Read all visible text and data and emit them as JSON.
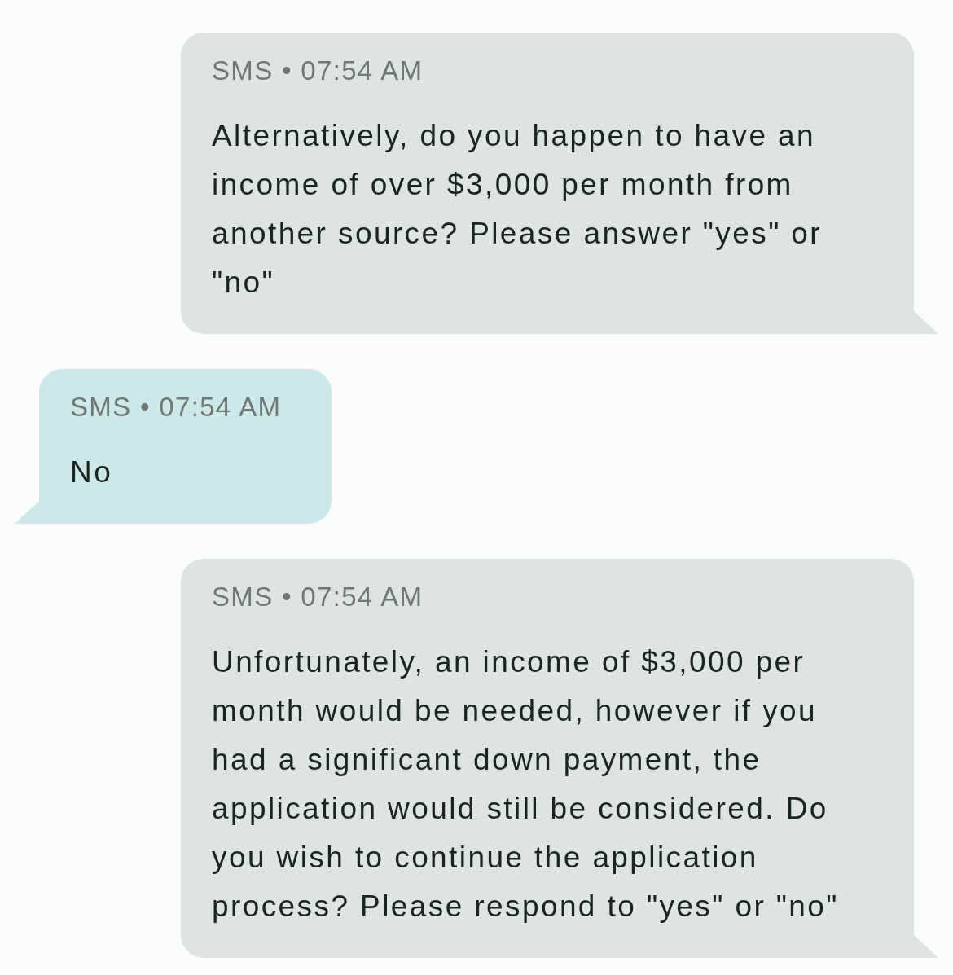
{
  "messages": [
    {
      "kind": "outgoing",
      "meta": "SMS • 07:54 AM",
      "text": "Alternatively, do you happen to have an income of over $3,000 per month from another source? Please answer \"yes\" or \"no\""
    },
    {
      "kind": "incoming",
      "meta": "SMS • 07:54 AM",
      "text": "No"
    },
    {
      "kind": "outgoing",
      "meta": "SMS • 07:54 AM",
      "text": "Unfortunately, an income of $3,000 per month would be needed, however if you had a significant down payment, the application would still be considered. Do you wish to continue the application process? Please respond to \"yes\" or \"no\""
    }
  ]
}
